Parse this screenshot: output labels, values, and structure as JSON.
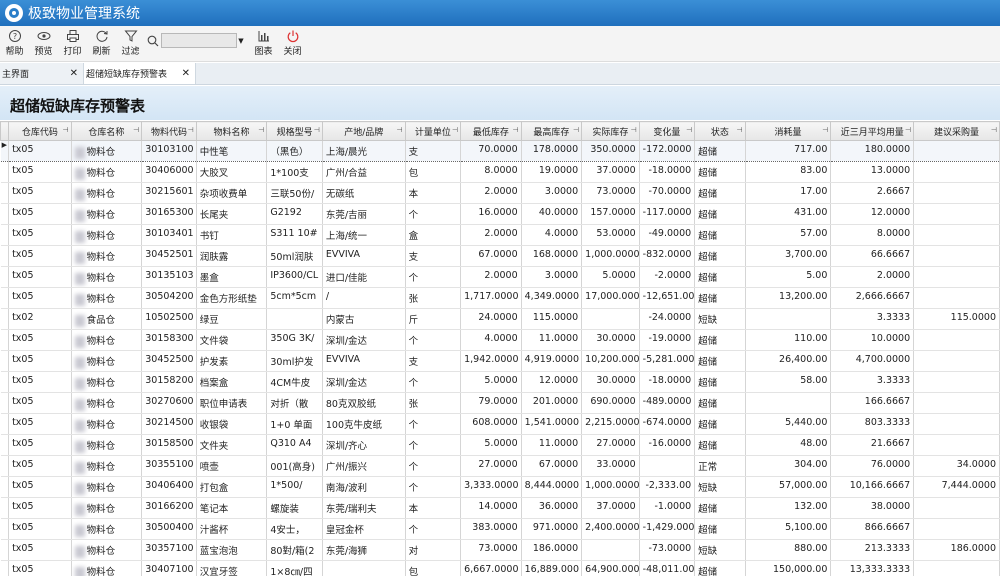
{
  "app": {
    "title": "极致物业管理系统"
  },
  "toolbar": {
    "buttons": [
      {
        "label": "帮助",
        "icon": "help-icon"
      },
      {
        "label": "预览",
        "icon": "eye-icon"
      },
      {
        "label": "打印",
        "icon": "printer-icon"
      },
      {
        "label": "刷新",
        "icon": "refresh-icon"
      },
      {
        "label": "过滤",
        "icon": "filter-icon"
      }
    ],
    "search_placeholder": "",
    "buttons2": [
      {
        "label": "图表",
        "icon": "chart-icon"
      },
      {
        "label": "关闭",
        "icon": "power-icon"
      }
    ]
  },
  "tabs": [
    {
      "label": "主界面"
    },
    {
      "label": "超储短缺库存预警表"
    }
  ],
  "report": {
    "title": "超储短缺库存预警表"
  },
  "columns": [
    "仓库代码",
    "仓库名称",
    "物料代码",
    "物料名称",
    "规格型号",
    "产地/品牌",
    "计量单位",
    "最低库存",
    "最高库存",
    "实际库存",
    "变化量",
    "状态",
    "消耗量",
    "近三月平均用量",
    "建议采购量"
  ],
  "rows": [
    [
      "tx05",
      "物料仓",
      "30103100",
      "中性笔",
      "（黑色）",
      "上海/晨光",
      "支",
      "70.0000",
      "178.0000",
      "350.0000",
      "-172.0000",
      "超储",
      "717.00",
      "180.0000",
      ""
    ],
    [
      "tx05",
      "物料仓",
      "30406000",
      "大胶叉",
      "1*100支",
      "广州/合益",
      "包",
      "8.0000",
      "19.0000",
      "37.0000",
      "-18.0000",
      "超储",
      "83.00",
      "13.0000",
      ""
    ],
    [
      "tx05",
      "物料仓",
      "30215601",
      "杂项收费单",
      "三联50份/",
      "无碳纸",
      "本",
      "2.0000",
      "3.0000",
      "73.0000",
      "-70.0000",
      "超储",
      "17.00",
      "2.6667",
      ""
    ],
    [
      "tx05",
      "物料仓",
      "30165300",
      "长尾夹",
      "G2192",
      "东莞/吉丽",
      "个",
      "16.0000",
      "40.0000",
      "157.0000",
      "-117.0000",
      "超储",
      "431.00",
      "12.0000",
      ""
    ],
    [
      "tx05",
      "物料仓",
      "30103401",
      "书钉",
      "S311 10#",
      "上海/统一",
      "盒",
      "2.0000",
      "4.0000",
      "53.0000",
      "-49.0000",
      "超储",
      "57.00",
      "8.0000",
      ""
    ],
    [
      "tx05",
      "物料仓",
      "30452501",
      "润肤露",
      "50ml润肤",
      "EVVIVA",
      "支",
      "67.0000",
      "168.0000",
      "1,000.0000",
      "-832.0000",
      "超储",
      "3,700.00",
      "66.6667",
      ""
    ],
    [
      "tx05",
      "物料仓",
      "30135103",
      "墨盒",
      "IP3600/CL",
      "进口/佳能",
      "个",
      "2.0000",
      "3.0000",
      "5.0000",
      "-2.0000",
      "超储",
      "5.00",
      "2.0000",
      ""
    ],
    [
      "tx05",
      "物料仓",
      "30504200",
      "金色方形纸垫",
      "5cm*5cm",
      "/",
      "张",
      "1,717.0000",
      "4,349.0000",
      "17,000.0000",
      "-12,651.00",
      "超储",
      "13,200.00",
      "2,666.6667",
      ""
    ],
    [
      "tx02",
      "食品仓",
      "10502500",
      "绿豆",
      "",
      "内蒙古",
      "斤",
      "24.0000",
      "115.0000",
      "",
      "-24.0000",
      "短缺",
      "",
      "3.3333",
      "115.0000"
    ],
    [
      "tx05",
      "物料仓",
      "30158300",
      "文件袋",
      "350G 3K/",
      "深圳/金达",
      "个",
      "4.0000",
      "11.0000",
      "30.0000",
      "-19.0000",
      "超储",
      "110.00",
      "10.0000",
      ""
    ],
    [
      "tx05",
      "物料仓",
      "30452500",
      "护发素",
      "30ml护发",
      "EVVIVA",
      "支",
      "1,942.0000",
      "4,919.0000",
      "10,200.0000",
      "-5,281.000",
      "超储",
      "26,400.00",
      "4,700.0000",
      ""
    ],
    [
      "tx05",
      "物料仓",
      "30158200",
      "档案盒",
      "4CM牛皮",
      "深圳/金达",
      "个",
      "5.0000",
      "12.0000",
      "30.0000",
      "-18.0000",
      "超储",
      "58.00",
      "3.3333",
      ""
    ],
    [
      "tx05",
      "物料仓",
      "30270600",
      "职位申请表",
      "对折（散",
      "80克双胶纸",
      "张",
      "79.0000",
      "201.0000",
      "690.0000",
      "-489.0000",
      "超储",
      "",
      "166.6667",
      ""
    ],
    [
      "tx05",
      "物料仓",
      "30214500",
      "收银袋",
      "1+0 单面",
      "100克牛皮纸",
      "个",
      "608.0000",
      "1,541.0000",
      "2,215.0000",
      "-674.0000",
      "超储",
      "5,440.00",
      "803.3333",
      ""
    ],
    [
      "tx05",
      "物料仓",
      "30158500",
      "文件夹",
      "Q310 A4",
      "深圳/齐心",
      "个",
      "5.0000",
      "11.0000",
      "27.0000",
      "-16.0000",
      "超储",
      "48.00",
      "21.6667",
      ""
    ],
    [
      "tx05",
      "物料仓",
      "30355100",
      "喷壶",
      "001(高身)",
      "广州/振兴",
      "个",
      "27.0000",
      "67.0000",
      "33.0000",
      "",
      "正常",
      "304.00",
      "76.0000",
      "34.0000"
    ],
    [
      "tx05",
      "物料仓",
      "30406400",
      "打包盒",
      "1*500/",
      "南海/波利",
      "个",
      "3,333.0000",
      "8,444.0000",
      "1,000.0000",
      "-2,333.00",
      "短缺",
      "57,000.00",
      "10,166.6667",
      "7,444.0000"
    ],
    [
      "tx05",
      "物料仓",
      "30166200",
      "笔记本",
      "螺旋装",
      "东莞/瑞利夫",
      "本",
      "14.0000",
      "36.0000",
      "37.0000",
      "-1.0000",
      "超储",
      "132.00",
      "38.0000",
      ""
    ],
    [
      "tx05",
      "物料仓",
      "30500400",
      "汁酱杯",
      "4安士，",
      "皇冠金杯",
      "个",
      "383.0000",
      "971.0000",
      "2,400.0000",
      "-1,429.000",
      "超储",
      "5,100.00",
      "866.6667",
      ""
    ],
    [
      "tx05",
      "物料仓",
      "30357100",
      "蓝宝泡泡",
      "80對/箱(2",
      "东莞/海狮",
      "对",
      "73.0000",
      "186.0000",
      "",
      "-73.0000",
      "短缺",
      "880.00",
      "213.3333",
      "186.0000"
    ],
    [
      "tx05",
      "物料仓",
      "30407100",
      "汉宜牙签",
      "1×8㎝/四",
      "",
      "包",
      "6,667.0000",
      "16,889.000",
      "64,900.0000",
      "-48,011.00",
      "超储",
      "150,000.00",
      "13,333.3333",
      ""
    ]
  ]
}
